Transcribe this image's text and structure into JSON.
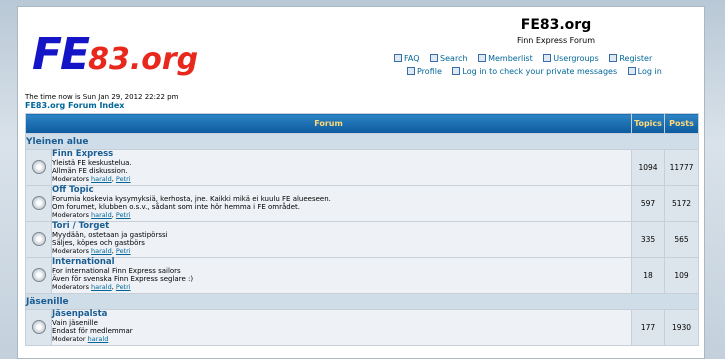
{
  "site": {
    "logo_prefix": "FE",
    "logo_suffix": "83.org",
    "title": "FE83.org",
    "description": "Finn Express Forum"
  },
  "nav": {
    "row1": [
      {
        "label": "FAQ",
        "icon": "faq-icon"
      },
      {
        "label": "Search",
        "icon": "search-icon"
      },
      {
        "label": "Memberlist",
        "icon": "memberlist-icon"
      },
      {
        "label": "Usergroups",
        "icon": "usergroups-icon"
      },
      {
        "label": "Register",
        "icon": "register-icon"
      }
    ],
    "row2": [
      {
        "label": "Profile",
        "icon": "profile-icon"
      },
      {
        "label": "Log in to check your private messages",
        "icon": "messages-icon"
      },
      {
        "label": "Log in",
        "icon": "login-icon"
      }
    ]
  },
  "time_text": "The time now is Sun Jan 29, 2012 22:22 pm",
  "index_link": "FE83.org Forum Index",
  "table": {
    "headers": {
      "forum": "Forum",
      "topics": "Topics",
      "posts": "Posts"
    },
    "categories": [
      {
        "name": "Yleinen alue",
        "forums": [
          {
            "name": "Finn Express",
            "desc": [
              "Yleistä FE keskustelua.",
              "Allmän FE diskussion."
            ],
            "mods_label": "Moderators",
            "mods": [
              "harald",
              "Petri"
            ],
            "topics": "1094",
            "posts": "11777"
          },
          {
            "name": "Off Topic",
            "desc": [
              "Forumia koskevia kysymyksiä, kerhosta, jne. Kaikki mikä ei kuulu FE alueeseen.",
              "Om forumet, klubben o.s.v., sådant som inte hör hemma i FE området."
            ],
            "mods_label": "Moderators",
            "mods": [
              "harald",
              "Petri"
            ],
            "topics": "597",
            "posts": "5172"
          },
          {
            "name": "Tori / Torget",
            "desc": [
              "Myydään, ostetaan ja gastipörssi",
              "Säljes, köpes och gastbörs"
            ],
            "mods_label": "Moderators",
            "mods": [
              "harald",
              "Petri"
            ],
            "topics": "335",
            "posts": "565"
          },
          {
            "name": "International",
            "desc": [
              "For international Finn Express sailors",
              "Även för svenska Finn Express seglare :)"
            ],
            "mods_label": "Moderators",
            "mods": [
              "harald",
              "Petri"
            ],
            "topics": "18",
            "posts": "109"
          }
        ]
      },
      {
        "name": "Jäsenille",
        "forums": [
          {
            "name": "Jäsenpalsta",
            "desc": [
              "Vain jäsenille",
              "Endast för medlemmar"
            ],
            "mods_label": "Moderator",
            "mods": [
              "harald"
            ],
            "topics": "177",
            "posts": "1930"
          }
        ]
      }
    ]
  }
}
